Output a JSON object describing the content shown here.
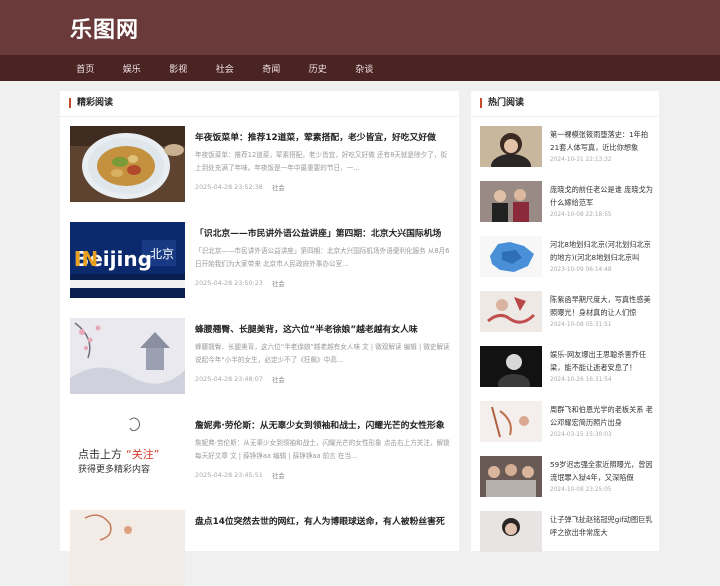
{
  "site": {
    "logo": "乐图网"
  },
  "nav": [
    "首页",
    "娱乐",
    "影视",
    "社会",
    "奇闻",
    "历史",
    "杂谈"
  ],
  "main": {
    "section_title": "精彩阅读",
    "articles": [
      {
        "title": "年夜饭菜单：推荐12道菜，荤素搭配，老少皆宜，好吃又好做",
        "summary": "年夜饭菜单：推荐12道菜，荤素搭配，老少皆宜，好吃又好做 还有8天就是除夕了，街上到处充满了年味。年夜饭是一年中最重要的节日，一...",
        "date": "2025-04-28 23:52:38",
        "category": "社会"
      },
      {
        "title": "「识北京——市民讲外语公益讲座」第四期：北京大兴国际机场",
        "summary": "「识北京——市民讲外语公益讲座」第四期：北京大兴国际机场外语便利化服务 从8月6日开始我们为大家带来 北京市人民政府外事办公室...",
        "date": "2025-04-28 23:50:23",
        "category": "社会"
      },
      {
        "title": "蜂腰翘臀、长腿美背，这六位“半老徐娘”越老越有女人味",
        "summary": "蜂腰翘臀、长腿美背，这六位“半老徐娘”越老越有女人味 文 | 微观解读 编辑 | 微史解读 说起今年“小半的女生，必定少不了《狂飙》中高...",
        "date": "2025-04-28 23:48:07",
        "category": "社会"
      },
      {
        "title": "詹妮弗·劳伦斯：从无辜少女到领袖和战士，闪耀光芒的女性形象",
        "summary": "詹妮弗·劳伦斯：从无辜少女到领袖和战士，闪耀光芒的女性形象 点击右上方关注，解锁每天好文章 文 | 薛铮铮aa 编辑 | 薛铮铮aa 前言 在当...",
        "date": "2025-04-28 23:45:51",
        "category": "社会"
      },
      {
        "title": "盘点14位突然去世的网红，有人为博眼球送命，有人被粉丝害死",
        "summary": "",
        "date": "",
        "category": ""
      }
    ]
  },
  "side": {
    "section_title": "热门阅读",
    "items": [
      {
        "title": "第一裸模张筱雨堕落史：1年拍21套人体写真，近比你想象",
        "date": "2024-10-31 22:13:32"
      },
      {
        "title": "庞晓戈的前任老公是谁 庞晓戈为什么嫁给范军",
        "date": "2024-10-08 22:18:55"
      },
      {
        "title": "河北8地划归北京(河北划归北京的地方)(河北8地划归北京叫",
        "date": "2023-10-09 06:14:48"
      },
      {
        "title": "陈紫函早期尺度大，写真性感美照曝光！身材真的让人们惊",
        "date": "2024-10-08 05:31:51"
      },
      {
        "title": "娱乐-网友爆出王思聪杀害乔任梁，能不能让逝者安息了！",
        "date": "2024-10-26 16:31:54"
      },
      {
        "title": "周群飞和伯恩光学的老板关系 老公邓耀宏简历照片出身",
        "date": "2024-03-15 15:30:03"
      },
      {
        "title": "59岁迟志强全家近照曝光，曾因流氓罪入狱4年，又深陷假",
        "date": "2024-10-08 23:25:05"
      },
      {
        "title": "让子弹飞扯赵铭冠兜gif动图巨乳呼之欲出非常庞大",
        "date": ""
      }
    ]
  }
}
